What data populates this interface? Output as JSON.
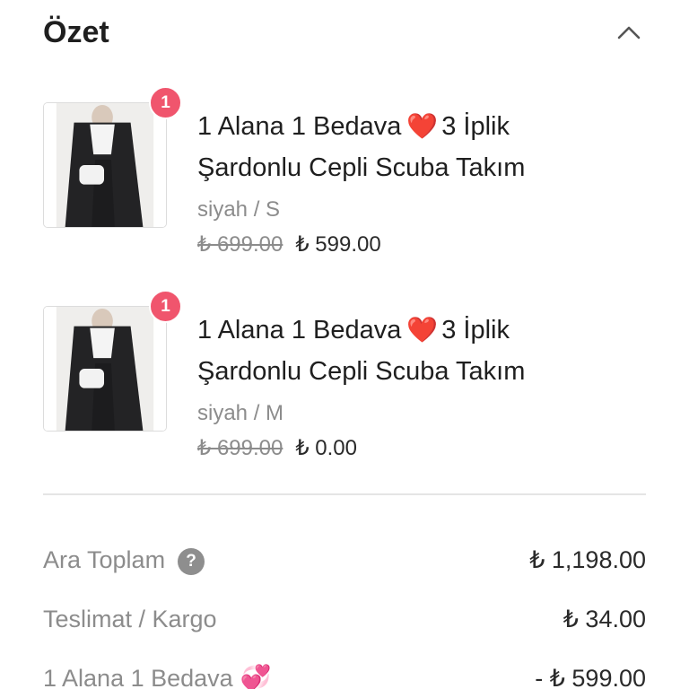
{
  "header": {
    "title": "Özet"
  },
  "items": [
    {
      "quantity": "1",
      "name_part1": "1 Alana 1 Bedava",
      "name_emoji": "❤️",
      "name_part2": "3 İplik Şardonlu Cepli Scuba Takım",
      "variant": "siyah / S",
      "old_price": "₺ 699.00",
      "price": "₺ 599.00"
    },
    {
      "quantity": "1",
      "name_part1": "1 Alana 1 Bedava",
      "name_emoji": "❤️",
      "name_part2": "3 İplik Şardonlu Cepli Scuba Takım",
      "variant": "siyah / M",
      "old_price": "₺ 699.00",
      "price": "₺ 0.00"
    }
  ],
  "summary": {
    "subtotal_label": "Ara Toplam",
    "subtotal_help": "?",
    "subtotal_value": "₺ 1,198.00",
    "shipping_label": "Teslimat / Kargo",
    "shipping_value": "₺ 34.00",
    "discount_label": "1 Alana 1 Bedava",
    "discount_emoji": "💞",
    "discount_value": "- ₺ 599.00"
  },
  "icons": {
    "collapse": "chevron-up-icon",
    "help": "question-circle-icon",
    "heart": "red-heart-emoji",
    "hearts": "revolving-hearts-emoji"
  },
  "colors": {
    "badge": "#f0556d",
    "muted_text": "#8c8c8c",
    "divider": "#e5e5e5"
  }
}
